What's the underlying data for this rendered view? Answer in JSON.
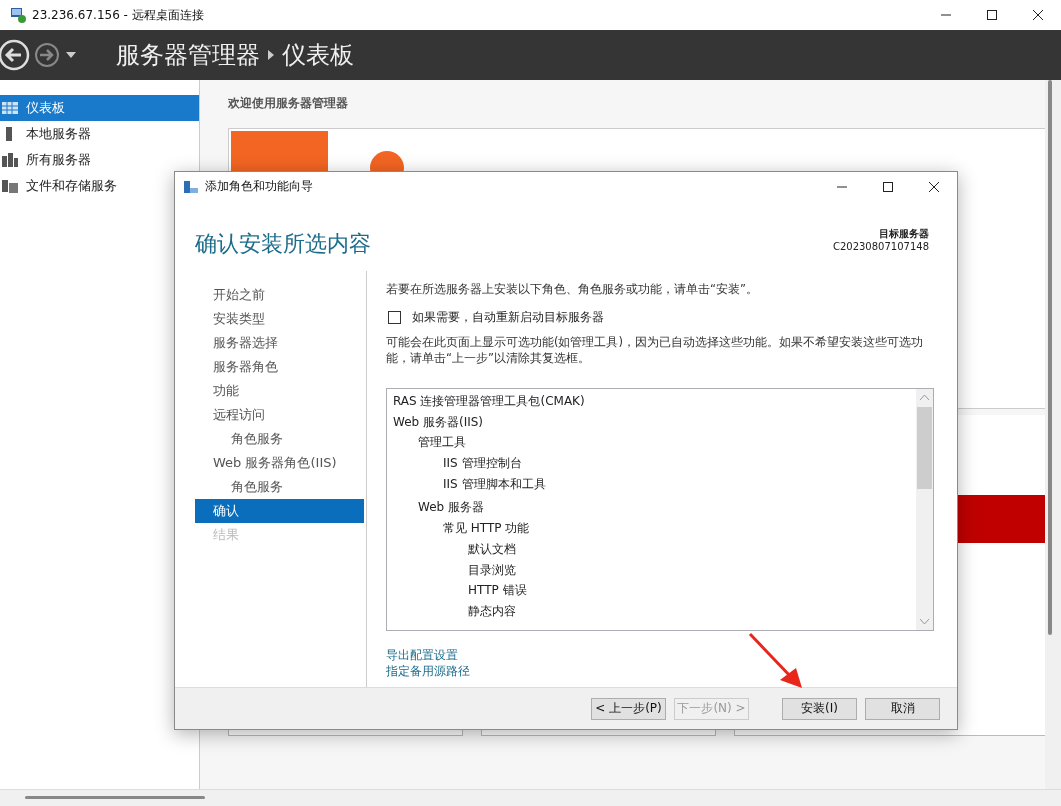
{
  "window": {
    "title": "23.236.67.156 - 远程桌面连接"
  },
  "header": {
    "breadcrumb": [
      "服务器管理器",
      "仪表板"
    ]
  },
  "sidebar": {
    "items": [
      {
        "label": "仪表板",
        "selected": true
      },
      {
        "label": "本地服务器",
        "selected": false
      },
      {
        "label": "所有服务器",
        "selected": false
      },
      {
        "label": "文件和存储服务",
        "selected": false
      }
    ]
  },
  "welcome": {
    "title": "欢迎使用服务器管理器"
  },
  "dialog": {
    "title": "添加角色和功能向导",
    "heading": "确认安装所选内容",
    "target_label": "目标服务器",
    "target_server": "C20230807107148",
    "nav": [
      {
        "label": "开始之前",
        "selected": false,
        "disabled": false
      },
      {
        "label": "安装类型",
        "selected": false,
        "disabled": false
      },
      {
        "label": "服务器选择",
        "selected": false,
        "disabled": false
      },
      {
        "label": "服务器角色",
        "selected": false,
        "disabled": false
      },
      {
        "label": "功能",
        "selected": false,
        "disabled": false
      },
      {
        "label": "远程访问",
        "selected": false,
        "disabled": false,
        "children": [
          {
            "label": "角色服务",
            "selected": false,
            "disabled": false
          }
        ]
      },
      {
        "label": "Web 服务器角色(IIS)",
        "selected": false,
        "disabled": false,
        "children": [
          {
            "label": "角色服务",
            "selected": false,
            "disabled": false
          }
        ]
      },
      {
        "label": "确认",
        "selected": true,
        "disabled": false
      },
      {
        "label": "结果",
        "selected": false,
        "disabled": true
      }
    ],
    "instruction": "若要在所选服务器上安装以下角色、角色服务或功能，请单击“安装”。",
    "restart_option": {
      "label": "如果需要，自动重新启动目标服务器",
      "checked": false
    },
    "note": "可能会在此页面上显示可选功能(如管理工具)，因为已自动选择这些功能。如果不希望安装这些可选功能，请单击“上一步”以清除其复选框。",
    "selections": [
      {
        "label": "RAS 连接管理器管理工具包(CMAK)"
      },
      {
        "label": "Web 服务器(IIS)",
        "children": [
          {
            "label": "管理工具",
            "children": [
              {
                "label": "IIS 管理控制台"
              },
              {
                "label": "IIS 管理脚本和工具"
              }
            ]
          },
          {
            "label": "Web 服务器",
            "children": [
              {
                "label": "常见 HTTP 功能",
                "children": [
                  {
                    "label": "默认文档"
                  },
                  {
                    "label": "目录浏览"
                  },
                  {
                    "label": "HTTP 错误"
                  },
                  {
                    "label": "静态内容"
                  }
                ]
              }
            ]
          }
        ]
      }
    ],
    "links": [
      "导出配置设置",
      "指定备用源路径"
    ],
    "buttons": [
      {
        "label": "< 上一步(P)",
        "disabled": false
      },
      {
        "label": "下一步(N) >",
        "disabled": true
      },
      {
        "label": "安装(I)",
        "disabled": false
      },
      {
        "label": "取消",
        "disabled": false
      }
    ]
  }
}
